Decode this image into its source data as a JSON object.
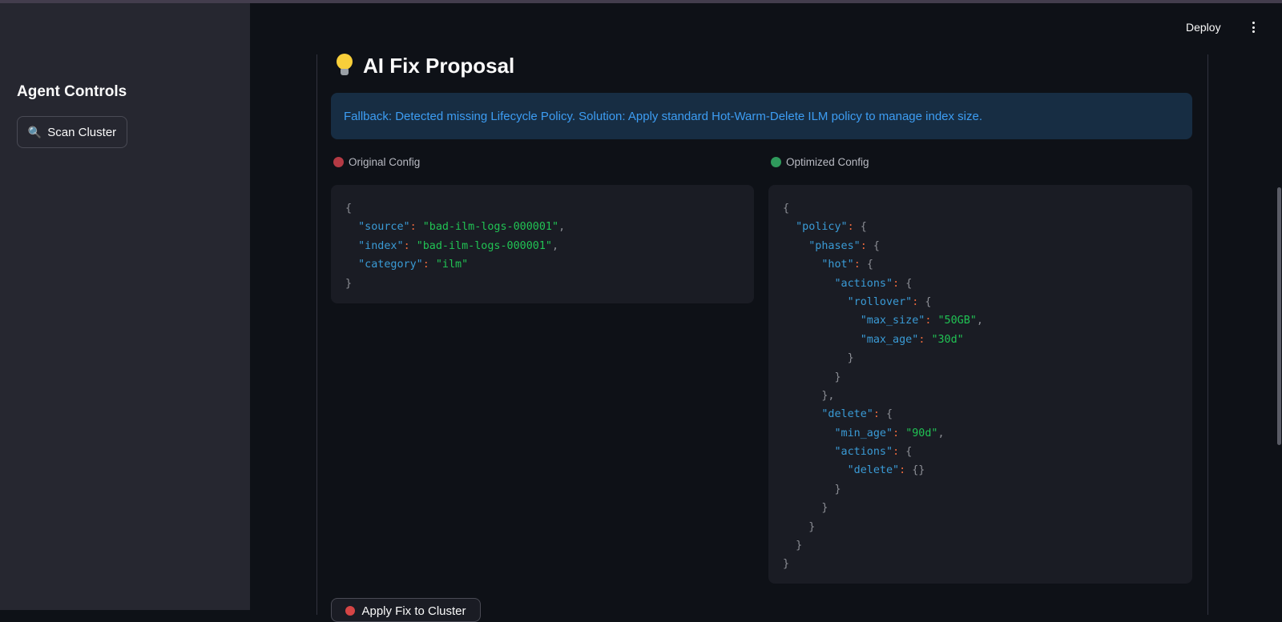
{
  "sidebar": {
    "title": "Agent Controls",
    "scan_button": {
      "icon": "magnifier-icon",
      "glyph": "🔍",
      "label": "Scan Cluster"
    }
  },
  "header": {
    "deploy_label": "Deploy",
    "menu_icon": "kebab-menu-icon"
  },
  "main": {
    "heading": "AI Fix Proposal",
    "heading_icon": "lightbulb-icon",
    "info_message": "Fallback: Detected missing Lifecycle Policy. Solution: Apply standard Hot-Warm-Delete ILM policy to manage index size.",
    "original": {
      "label": "Original Config",
      "indicator_color": "#b43a44",
      "lines": [
        [
          [
            "{",
            "b"
          ]
        ],
        [
          [
            "  ",
            "b"
          ],
          [
            "\"source\"",
            "k"
          ],
          [
            ": ",
            "p"
          ],
          [
            "\"bad-ilm-logs-000001\"",
            "s"
          ],
          [
            ",",
            "b"
          ]
        ],
        [
          [
            "  ",
            "b"
          ],
          [
            "\"index\"",
            "k"
          ],
          [
            ": ",
            "p"
          ],
          [
            "\"bad-ilm-logs-000001\"",
            "s"
          ],
          [
            ",",
            "b"
          ]
        ],
        [
          [
            "  ",
            "b"
          ],
          [
            "\"category\"",
            "k"
          ],
          [
            ": ",
            "p"
          ],
          [
            "\"ilm\"",
            "s"
          ]
        ],
        [
          [
            "}",
            "b"
          ]
        ]
      ]
    },
    "optimized": {
      "label": "Optimized Config",
      "indicator_color": "#2f9a5c",
      "lines": [
        [
          [
            "{",
            "b"
          ]
        ],
        [
          [
            "  ",
            "b"
          ],
          [
            "\"policy\"",
            "k"
          ],
          [
            ": ",
            "p"
          ],
          [
            "{",
            "b"
          ]
        ],
        [
          [
            "    ",
            "b"
          ],
          [
            "\"phases\"",
            "k"
          ],
          [
            ": ",
            "p"
          ],
          [
            "{",
            "b"
          ]
        ],
        [
          [
            "      ",
            "b"
          ],
          [
            "\"hot\"",
            "k"
          ],
          [
            ": ",
            "p"
          ],
          [
            "{",
            "b"
          ]
        ],
        [
          [
            "        ",
            "b"
          ],
          [
            "\"actions\"",
            "k"
          ],
          [
            ": ",
            "p"
          ],
          [
            "{",
            "b"
          ]
        ],
        [
          [
            "          ",
            "b"
          ],
          [
            "\"rollover\"",
            "k"
          ],
          [
            ": ",
            "p"
          ],
          [
            "{",
            "b"
          ]
        ],
        [
          [
            "            ",
            "b"
          ],
          [
            "\"max_size\"",
            "k"
          ],
          [
            ": ",
            "p"
          ],
          [
            "\"50GB\"",
            "s"
          ],
          [
            ",",
            "b"
          ]
        ],
        [
          [
            "            ",
            "b"
          ],
          [
            "\"max_age\"",
            "k"
          ],
          [
            ": ",
            "p"
          ],
          [
            "\"30d\"",
            "s"
          ]
        ],
        [
          [
            "          }",
            "b"
          ]
        ],
        [
          [
            "        }",
            "b"
          ]
        ],
        [
          [
            "      },",
            "b"
          ]
        ],
        [
          [
            "      ",
            "b"
          ],
          [
            "\"delete\"",
            "k"
          ],
          [
            ": ",
            "p"
          ],
          [
            "{",
            "b"
          ]
        ],
        [
          [
            "        ",
            "b"
          ],
          [
            "\"min_age\"",
            "k"
          ],
          [
            ": ",
            "p"
          ],
          [
            "\"90d\"",
            "s"
          ],
          [
            ",",
            "b"
          ]
        ],
        [
          [
            "        ",
            "b"
          ],
          [
            "\"actions\"",
            "k"
          ],
          [
            ": ",
            "p"
          ],
          [
            "{",
            "b"
          ]
        ],
        [
          [
            "          ",
            "b"
          ],
          [
            "\"delete\"",
            "k"
          ],
          [
            ": ",
            "p"
          ],
          [
            "{}",
            "b"
          ]
        ],
        [
          [
            "        }",
            "b"
          ]
        ],
        [
          [
            "      }",
            "b"
          ]
        ],
        [
          [
            "    }",
            "b"
          ]
        ],
        [
          [
            "  }",
            "b"
          ]
        ],
        [
          [
            "}",
            "b"
          ]
        ]
      ]
    },
    "apply_button": {
      "icon": "rocket-icon",
      "label": "Apply Fix to Cluster"
    }
  }
}
